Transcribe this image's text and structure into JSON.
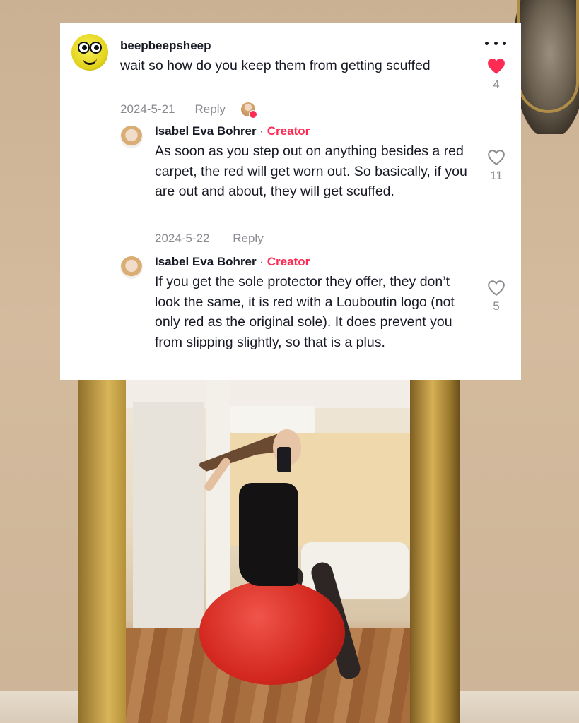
{
  "comment": {
    "username": "beepbeepsheep",
    "text": "wait so how do you keep them from getting scuffed",
    "date": "2024-5-21",
    "reply_label": "Reply",
    "like_count": "4",
    "liked": true,
    "heart_color": "#fe2c55"
  },
  "replies": [
    {
      "name": "Isabel Eva Bohrer",
      "separator": "·",
      "badge": "Creator",
      "text": "As soon as you step out on anything besides a red carpet, the red will get worn out. So basically, if you are out and about, they will get scuffed.",
      "date": "2024-5-22",
      "reply_label": "Reply",
      "like_count": "11"
    },
    {
      "name": "Isabel Eva Bohrer",
      "separator": "·",
      "badge": "Creator",
      "text": "If you get the sole protector they offer, they don’t look the same, it is red with a Louboutin logo (not only red as the original sole). It does prevent you from slipping slightly, so that is a plus.",
      "like_count": "5"
    }
  ],
  "icons": {
    "more": "more-options-icon",
    "like_filled": "heart-filled-icon",
    "like_outline": "heart-outline-icon"
  },
  "accent": "#fe2c55"
}
